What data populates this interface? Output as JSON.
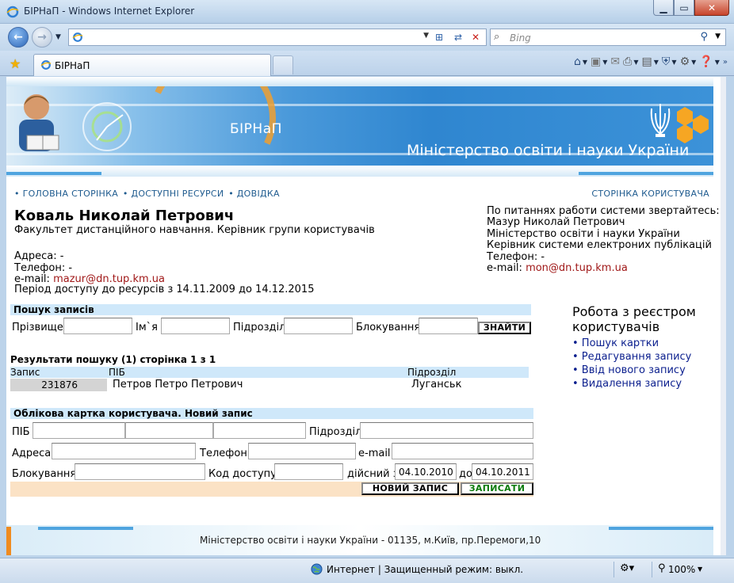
{
  "window": {
    "title": "БІРНаП - Windows Internet Explorer"
  },
  "search": {
    "placeholder": "Bing"
  },
  "tab": {
    "label": "БІРНаП"
  },
  "banner": {
    "brand": "БІРНаП",
    "ministry": "Міністерство освіти і науки України"
  },
  "nav": {
    "home": "• ГОЛОВНА СТОРІНКА",
    "resources": "• ДОСТУПНІ РЕСУРСИ",
    "help": "• ДОВІДКА",
    "user_page": "СТОРІНКА КОРИСТУВАЧА"
  },
  "user": {
    "name": "Коваль Николай Петрович",
    "position": "Факультет дистанційного навчання. Керівник групи користувачів",
    "address": "Адреса: -",
    "phone": "Телефон: -",
    "email_label": "e-mail: ",
    "email": "mazur@dn.tup.km.ua",
    "period": "Період доступу до ресурсів з 14.11.2009 до 14.12.2015"
  },
  "contacts": {
    "line1": "По питаннях работи системи звертайтесь:",
    "line2": "Мазур Николай Петрович",
    "line3": "Міністерство освіти і науки України",
    "line4": "Керівник системи електроних публікацій",
    "line5": "Телефон: -",
    "email_label": "e-mail: ",
    "email": "mon@dn.tup.km.ua"
  },
  "search_form": {
    "title": "Пошук записів",
    "surname": "Прізвище",
    "name": "Ім`я",
    "unit": "Підрозділ",
    "block": "Блокування",
    "find": "ЗНАЙТИ"
  },
  "results": {
    "title": "Результати пошуку (1) сторінка 1 з 1",
    "headers": [
      "Запис",
      "ПІБ",
      "Підрозділ"
    ],
    "rows": [
      {
        "id": "231876",
        "name": "Петров Петро Петрович",
        "unit": "Луганськ"
      }
    ]
  },
  "right_panel": {
    "title_line1": "Робота з реєстром",
    "title_line2": "користувачів",
    "items": [
      "• Пошук картки",
      "• Редагування запису",
      "• Ввід нового запису",
      "• Видалення запису"
    ]
  },
  "card": {
    "title": "Облікова картка користувача. Новий запис",
    "pib": "ПІБ",
    "unit": "Підрозділ",
    "address": "Адреса",
    "phone": "Телефон",
    "email": "e-mail",
    "block": "Блокування",
    "access_code": "Код доступу",
    "valid_from": "дійсний з",
    "valid_from_value": "04.10.2010",
    "to": "до",
    "valid_to_value": "04.10.2011",
    "new_record": "НОВИЙ ЗАПИС",
    "save": "ЗАПИСАТИ"
  },
  "footer": {
    "text": "Міністерство освіти і науки України - 01135, м.Київ, пр.Перемоги,10"
  },
  "status": {
    "zone": "Интернет | Защищенный режим: выкл.",
    "zoom": "100%"
  },
  "colors": {
    "link": "#a01818",
    "nav": "#1f5b8f",
    "section": "#cfe8fa",
    "action_bar": "#fbe2c5",
    "save_green": "#0a7a0a"
  }
}
